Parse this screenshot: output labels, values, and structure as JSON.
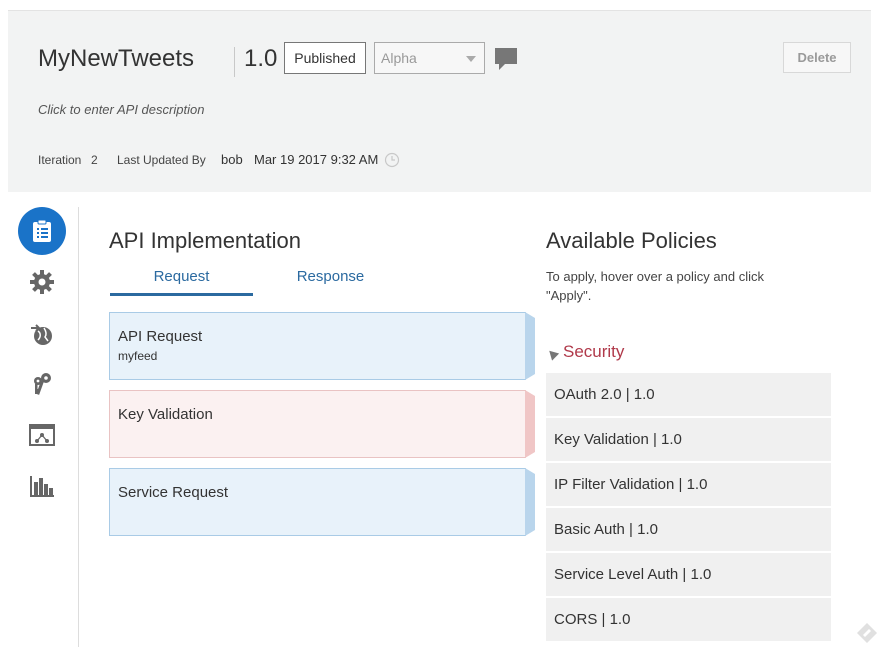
{
  "header": {
    "api_name": "MyNewTweets",
    "version": "1.0",
    "status_label": "Published",
    "stage_value": "Alpha",
    "delete_label": "Delete",
    "description_placeholder": "Click to enter API description",
    "iteration_label": "Iteration",
    "iteration_value": "2",
    "last_updated_label": "Last Updated By",
    "last_updated_user": "bob",
    "last_updated_time": "Mar 19 2017 9:32 AM"
  },
  "sidebar": {
    "items": [
      {
        "icon": "api-implementation-icon",
        "active": true
      },
      {
        "icon": "settings-gear-icon",
        "active": false
      },
      {
        "icon": "globe-deploy-icon",
        "active": false
      },
      {
        "icon": "keys-grants-icon",
        "active": false
      },
      {
        "icon": "publication-icon",
        "active": false
      },
      {
        "icon": "analytics-chart-icon",
        "active": false
      }
    ]
  },
  "implementation": {
    "title": "API Implementation",
    "tabs": [
      {
        "label": "Request",
        "active": true
      },
      {
        "label": "Response",
        "active": false
      }
    ],
    "flow": [
      {
        "label": "API Request",
        "sub": "myfeed"
      },
      {
        "label": "Key Validation",
        "sub": ""
      },
      {
        "label": "Service Request",
        "sub": ""
      }
    ]
  },
  "policies": {
    "title": "Available Policies",
    "hint": "To apply, hover over a policy and click \"Apply\".",
    "group": "Security",
    "items": [
      "OAuth 2.0 | 1.0",
      "Key Validation | 1.0",
      "IP Filter Validation | 1.0",
      "Basic Auth | 1.0",
      "Service Level Auth | 1.0",
      "CORS | 1.0"
    ]
  },
  "colors": {
    "accent": "#1a73c8",
    "tab_blue": "#2b6aa0",
    "security_red": "#b0394a",
    "request_bg": "#e8f2fa",
    "key_bg": "#fbf1f1"
  }
}
